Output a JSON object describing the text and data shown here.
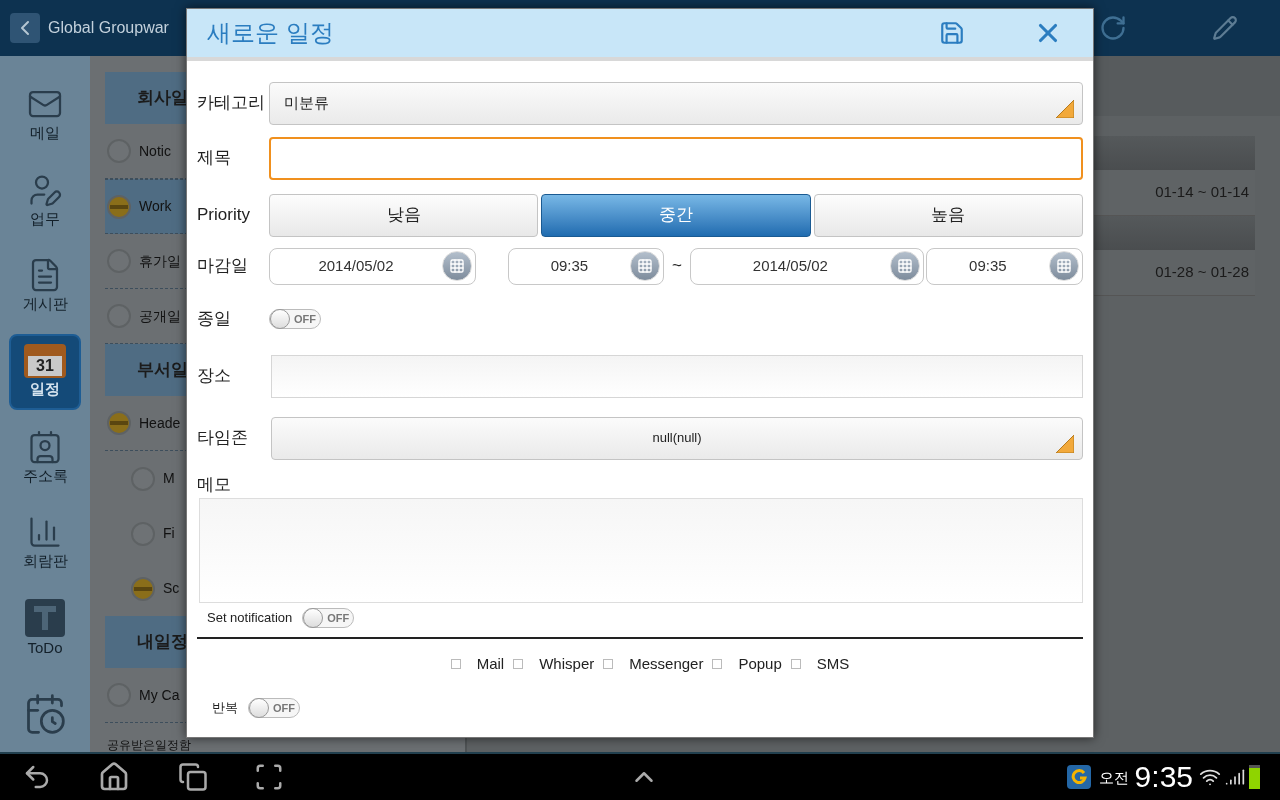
{
  "app_bar": {
    "title": "Global Groupwar"
  },
  "sidebar": {
    "items": [
      {
        "kind": "mail",
        "label": "메일",
        "selected": false
      },
      {
        "kind": "task",
        "label": "업무",
        "selected": false
      },
      {
        "kind": "board",
        "label": "게시판",
        "selected": false
      },
      {
        "kind": "calendar",
        "label": "일정",
        "badge": "31",
        "selected": true
      },
      {
        "kind": "contacts",
        "label": "주소록",
        "selected": false
      },
      {
        "kind": "chart",
        "label": "회람판",
        "selected": false
      },
      {
        "kind": "todo",
        "label": "ToDo",
        "selected": false
      },
      {
        "kind": "schedule",
        "selected": false
      }
    ]
  },
  "calendar_groups": [
    {
      "label": "회사일",
      "items": [
        {
          "label": "Notic",
          "checked": false,
          "selected": false
        },
        {
          "label": "Work",
          "checked": true,
          "selected": true
        },
        {
          "label": "휴가일",
          "checked": false,
          "selected": false
        },
        {
          "label": "공개일",
          "checked": false,
          "selected": false
        }
      ]
    },
    {
      "label": "부서일",
      "items": [
        {
          "label": "Heade",
          "checked": true,
          "selected": false,
          "children": [
            {
              "label": "M",
              "checked": false,
              "selected": false
            },
            {
              "label": "Fi",
              "checked": false,
              "selected": false
            },
            {
              "label": "Sc",
              "checked": true,
              "selected": false
            }
          ]
        }
      ]
    },
    {
      "label": "내일정",
      "items": [
        {
          "label": "My Ca",
          "checked": false,
          "selected": false
        }
      ]
    }
  ],
  "shared_label": "공유받은일정함",
  "schedule_rows": [
    "01-14 ~ 01-14",
    "01-28 ~ 01-28"
  ],
  "dialog": {
    "title": "새로운 일정",
    "category": {
      "label": "카테고리",
      "value": "미분류"
    },
    "subject": {
      "label": "제목",
      "focused": true
    },
    "priority": {
      "label": "Priority",
      "options": [
        {
          "label": "낮음",
          "selected": false
        },
        {
          "label": "중간",
          "selected": true
        },
        {
          "label": "높음",
          "selected": false
        }
      ]
    },
    "deadline": {
      "label": "마감일",
      "start_date": "2014/05/02",
      "start_time": "09:35",
      "separator": "~",
      "end_date": "2014/05/02",
      "end_time": "09:35"
    },
    "all_day": {
      "label": "종일",
      "on": false,
      "text": "OFF"
    },
    "place": {
      "label": "장소"
    },
    "timezone": {
      "label": "타임존",
      "value": "null(null)"
    },
    "memo": {
      "label": "메모"
    },
    "notification": {
      "label": "Set notification",
      "on": false,
      "text": "OFF"
    },
    "channels": [
      {
        "label": "Mail",
        "checked": false
      },
      {
        "label": "Whisper",
        "checked": false
      },
      {
        "label": "Messenger",
        "checked": false
      },
      {
        "label": "Popup",
        "checked": false
      },
      {
        "label": "SMS",
        "checked": false
      }
    ],
    "repeat": {
      "label": "반복",
      "on": false,
      "text": "OFF"
    }
  },
  "status_bar": {
    "ampm": "오전",
    "time": "9:35"
  }
}
